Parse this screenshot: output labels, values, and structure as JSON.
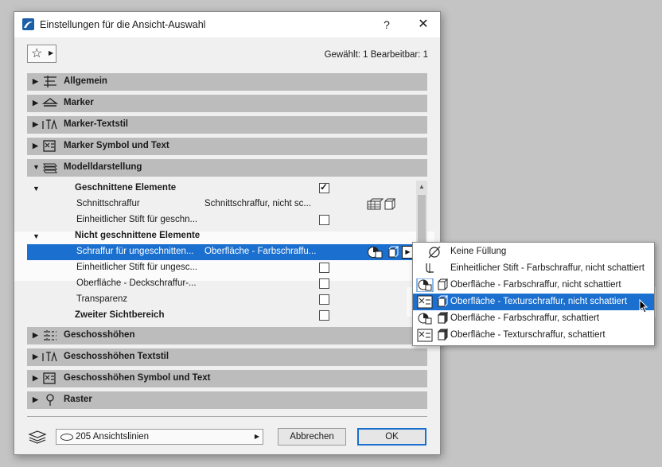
{
  "window": {
    "title": "Einstellungen für die Ansicht-Auswahl",
    "help": "?",
    "close": "✕"
  },
  "selection_info": "Gewählt: 1 Bearbeitbar: 1",
  "sections_top": [
    {
      "label": "Allgemein",
      "icon": "general-settings-icon"
    },
    {
      "label": "Marker",
      "icon": "marker-icon"
    },
    {
      "label": "Marker-Textstil",
      "icon": "text-style-icon"
    },
    {
      "label": "Marker Symbol und Text",
      "icon": "symbol-text-icon"
    },
    {
      "label": "Modelldarstellung",
      "icon": "model-display-icon"
    }
  ],
  "tree": {
    "cut": {
      "header": "Geschnittene Elemente",
      "hatch_label": "Schnittschraffur",
      "hatch_value": "Schnittschraffur, nicht sc...",
      "pen_label": "Einheitlicher Stift für geschn..."
    },
    "uncut": {
      "header": "Nicht geschnittene Elemente",
      "hatch_label": "Schraffur für ungeschnitten...",
      "hatch_value": "Oberfläche - Farbschraffu...",
      "pen_label": "Einheitlicher Stift für ungesc...",
      "surface_label": "Oberfläche - Deckschraffur-...",
      "transparency_label": "Transparenz"
    },
    "second": {
      "label": "Zweiter Sichtbereich"
    }
  },
  "sections_bottom": [
    {
      "label": "Geschosshöhen",
      "icon": "story-levels-icon"
    },
    {
      "label": "Geschosshöhen Textstil",
      "icon": "text-style-icon"
    },
    {
      "label": "Geschosshöhen Symbol und Text",
      "icon": "symbol-text-icon"
    },
    {
      "label": "Raster",
      "icon": "grid-icon"
    }
  ],
  "footer": {
    "layer": "205 Ansichtslinien",
    "cancel": "Abbrechen",
    "ok": "OK"
  },
  "popup": {
    "items": [
      "Keine Füllung",
      "Einheitlicher Stift - Farbschraffur, nicht schattiert",
      "Oberfläche - Farbschraffur, nicht schattiert",
      "Oberfläche - Texturschraffur, nicht schattiert",
      "Oberfläche - Farbschraffur, schattiert",
      "Oberfläche - Texturschraffur, schattiert"
    ],
    "selected_index": 3
  },
  "colors": {
    "accent": "#1a6fcf",
    "section_bg": "#bcbcbc",
    "dialog_bg": "#f0f0f0"
  }
}
